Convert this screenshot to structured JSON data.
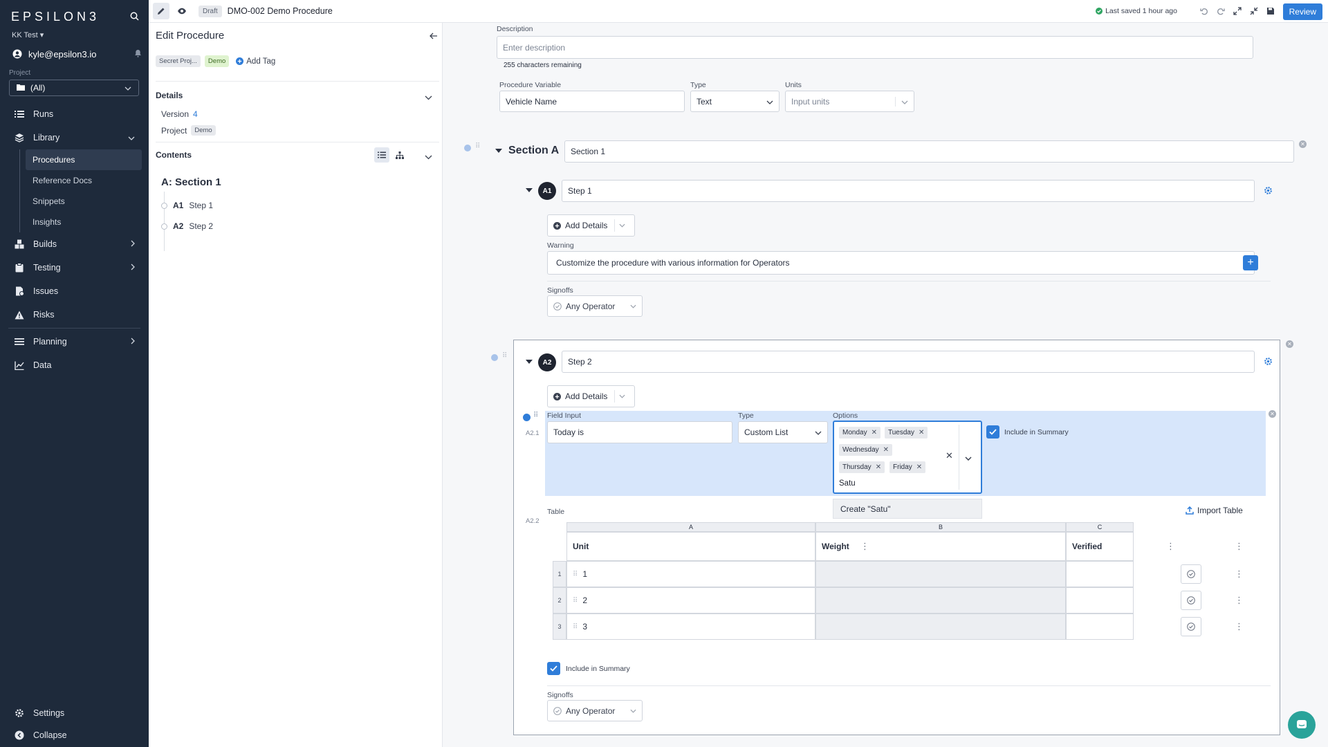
{
  "sidebar": {
    "logo": "EPSILON3",
    "org": "KK Test ▾",
    "user_email": "kyle@epsilon3.io",
    "project_label": "Project",
    "project_value": "(All)",
    "nav": {
      "runs": "Runs",
      "library": "Library",
      "procedures": "Procedures",
      "reference_docs": "Reference Docs",
      "snippets": "Snippets",
      "insights": "Insights",
      "builds": "Builds",
      "testing": "Testing",
      "issues": "Issues",
      "risks": "Risks",
      "planning": "Planning",
      "data": "Data",
      "settings": "Settings",
      "collapse": "Collapse"
    }
  },
  "topbar": {
    "draft": "Draft",
    "title": "DMO-002 Demo Procedure",
    "saved": "Last saved 1 hour ago",
    "review": "Review"
  },
  "edit_panel": {
    "title": "Edit Procedure",
    "tags": [
      "Secret Proj...",
      "Demo"
    ],
    "add_tag": "Add Tag",
    "details_label": "Details",
    "version_label": "Version",
    "version_value": "4",
    "project_label": "Project",
    "project_value": "Demo",
    "contents_label": "Contents",
    "toc_section": "A: Section 1",
    "toc_items": [
      {
        "id": "A1",
        "label": "Step 1"
      },
      {
        "id": "A2",
        "label": "Step 2"
      }
    ]
  },
  "main": {
    "description_label": "Description",
    "description_placeholder": "Enter description",
    "chars_remaining": "255 characters remaining",
    "proc_var_label": "Procedure Variable",
    "proc_var_value": "Vehicle Name",
    "type_label": "Type",
    "type_value": "Text",
    "units_label": "Units",
    "units_placeholder": "Input units",
    "section_label": "Section A",
    "section_name": "Section 1",
    "step1": {
      "badge": "A1",
      "name": "Step 1",
      "add_details": "Add Details",
      "warning_label": "Warning",
      "warning_text": "Customize the procedure with various information for Operators",
      "signoffs_label": "Signoffs",
      "signoff_value": "Any Operator"
    },
    "step2": {
      "badge": "A2",
      "name": "Step 2",
      "add_details": "Add Details",
      "a21": "A2.1",
      "field_input_label": "Field Input",
      "field_input_value": "Today is",
      "type_label": "Type",
      "type_value": "Custom List",
      "options_label": "Options",
      "options": [
        "Monday",
        "Tuesday",
        "Wednesday",
        "Thursday",
        "Friday"
      ],
      "options_typed": "Satu",
      "create_option": "Create \"Satu\"",
      "include_summary": "Include in Summary",
      "a22": "A2.2",
      "table_label": "Table",
      "import_table": "Import Table",
      "col_letters": [
        "A",
        "B",
        "C"
      ],
      "col_headers": [
        "Unit",
        "Weight",
        "Verified"
      ],
      "rows": [
        {
          "num": "1",
          "unit": "1"
        },
        {
          "num": "2",
          "unit": "2"
        },
        {
          "num": "3",
          "unit": "3"
        }
      ],
      "include_summary_2": "Include in Summary",
      "signoffs_label": "Signoffs",
      "signoff_value": "Any Operator"
    }
  },
  "colors": {
    "sidebar_bg": "#1e2a3b",
    "accent": "#2f7dd9",
    "selection_bg": "#d7e6fb",
    "demo_tag": "#dff3cf"
  }
}
